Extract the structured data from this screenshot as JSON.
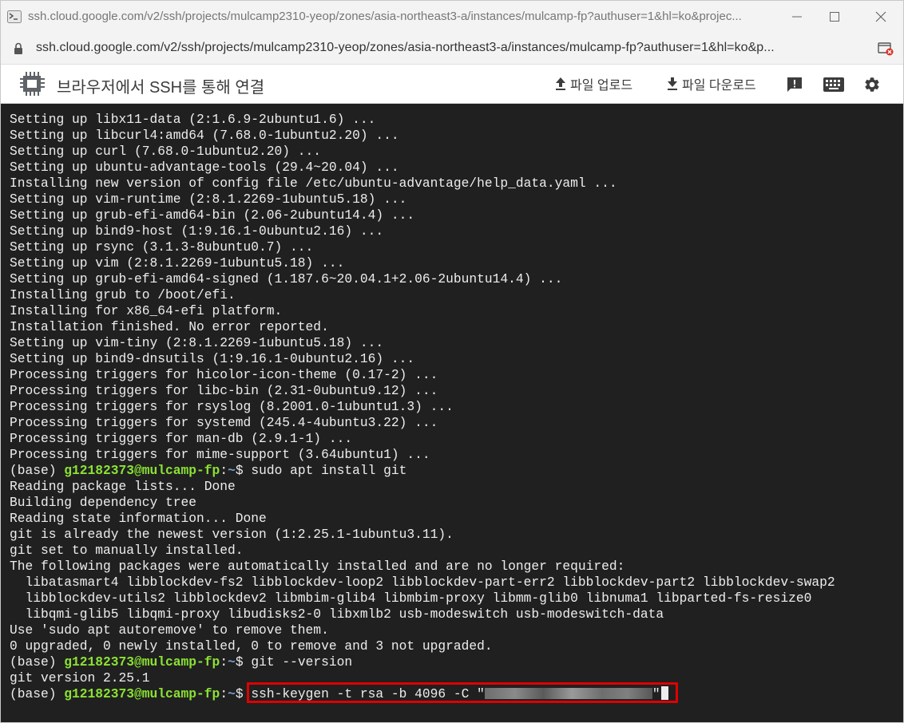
{
  "window": {
    "title": "ssh.cloud.google.com/v2/ssh/projects/mulcamp2310-yeop/zones/asia-northeast3-a/instances/mulcamp-fp?authuser=1&hl=ko&projec...",
    "url": "ssh.cloud.google.com/v2/ssh/projects/mulcamp2310-yeop/zones/asia-northeast3-a/instances/mulcamp-fp?authuser=1&hl=ko&p..."
  },
  "toolbar": {
    "app_title": "브라우저에서 SSH를 통해 연결",
    "upload_label": "파일 업로드",
    "download_label": "파일 다운로드"
  },
  "icons": {
    "favicon": "terminal-icon",
    "minimize": "minimize-icon",
    "maximize": "maximize-icon",
    "close": "close-icon",
    "lock": "lock-icon",
    "extension": "blocked-popup-icon",
    "chip": "chip-icon",
    "upload": "upload-icon",
    "download": "download-icon",
    "feedback": "feedback-icon",
    "keyboard": "keyboard-icon",
    "settings": "gear-icon"
  },
  "colors": {
    "terminal_bg": "#202020",
    "terminal_fg": "#ededed",
    "prompt_user": "#8ae234",
    "prompt_path": "#729fcf",
    "highlight": "#e00000"
  },
  "terminal": {
    "prompt": {
      "env": "(base) ",
      "user_host": "g12182373@mulcamp-fp",
      "colon": ":",
      "path": "~",
      "dollar": "$ "
    },
    "lines_before_prompt1": [
      "Setting up libx11-data (2:1.6.9-2ubuntu1.6) ...",
      "Setting up libcurl4:amd64 (7.68.0-1ubuntu2.20) ...",
      "Setting up curl (7.68.0-1ubuntu2.20) ...",
      "Setting up ubuntu-advantage-tools (29.4~20.04) ...",
      "Installing new version of config file /etc/ubuntu-advantage/help_data.yaml ...",
      "Setting up vim-runtime (2:8.1.2269-1ubuntu5.18) ...",
      "Setting up grub-efi-amd64-bin (2.06-2ubuntu14.4) ...",
      "Setting up bind9-host (1:9.16.1-0ubuntu2.16) ...",
      "Setting up rsync (3.1.3-8ubuntu0.7) ...",
      "Setting up vim (2:8.1.2269-1ubuntu5.18) ...",
      "Setting up grub-efi-amd64-signed (1.187.6~20.04.1+2.06-2ubuntu14.4) ...",
      "Installing grub to /boot/efi.",
      "Installing for x86_64-efi platform.",
      "Installation finished. No error reported.",
      "Setting up vim-tiny (2:8.1.2269-1ubuntu5.18) ...",
      "Setting up bind9-dnsutils (1:9.16.1-0ubuntu2.16) ...",
      "Processing triggers for hicolor-icon-theme (0.17-2) ...",
      "Processing triggers for libc-bin (2.31-0ubuntu9.12) ...",
      "Processing triggers for rsyslog (8.2001.0-1ubuntu1.3) ...",
      "Processing triggers for systemd (245.4-4ubuntu3.22) ...",
      "Processing triggers for man-db (2.9.1-1) ...",
      "Processing triggers for mime-support (3.64ubuntu1) ..."
    ],
    "cmd1": "sudo apt install git",
    "lines_after_cmd1": [
      "Reading package lists... Done",
      "Building dependency tree",
      "Reading state information... Done",
      "git is already the newest version (1:2.25.1-1ubuntu3.11).",
      "git set to manually installed.",
      "The following packages were automatically installed and are no longer required:",
      "  libatasmart4 libblockdev-fs2 libblockdev-loop2 libblockdev-part-err2 libblockdev-part2 libblockdev-swap2",
      "  libblockdev-utils2 libblockdev2 libmbim-glib4 libmbim-proxy libmm-glib0 libnuma1 libparted-fs-resize0",
      "  libqmi-glib5 libqmi-proxy libudisks2-0 libxmlb2 usb-modeswitch usb-modeswitch-data",
      "Use 'sudo apt autoremove' to remove them.",
      "0 upgraded, 0 newly installed, 0 to remove and 3 not upgraded."
    ],
    "cmd2": "git --version",
    "lines_after_cmd2": [
      "git version 2.25.1"
    ],
    "cmd3": "ssh-keygen -t rsa -b 4096 -C \"",
    "cmd3_end": "\""
  }
}
